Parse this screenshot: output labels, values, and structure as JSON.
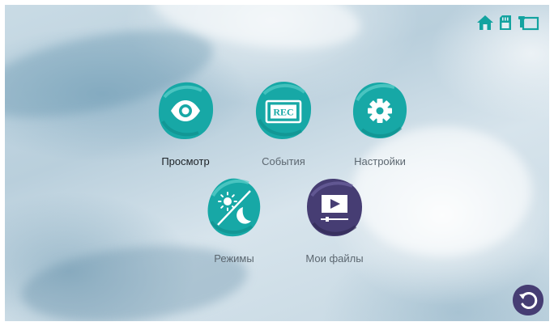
{
  "status_icons": [
    "home-icon",
    "sd-card-icon",
    "camera-feed-icon"
  ],
  "menu": {
    "items": [
      {
        "label": "Просмотр",
        "icon": "eye-icon",
        "active": true
      },
      {
        "label": "События",
        "icon": "rec-icon",
        "active": false
      },
      {
        "label": "Настройки",
        "icon": "gear-icon",
        "active": false
      },
      {
        "label": "Режимы",
        "icon": "day-night-icon",
        "active": false
      },
      {
        "label": "Мои файлы",
        "icon": "video-file-icon",
        "active": false
      }
    ]
  },
  "rec_badge": "REC",
  "colors": {
    "teal": "#17a8a6",
    "purple": "#463d73",
    "status_icon": "#13a3a0"
  }
}
